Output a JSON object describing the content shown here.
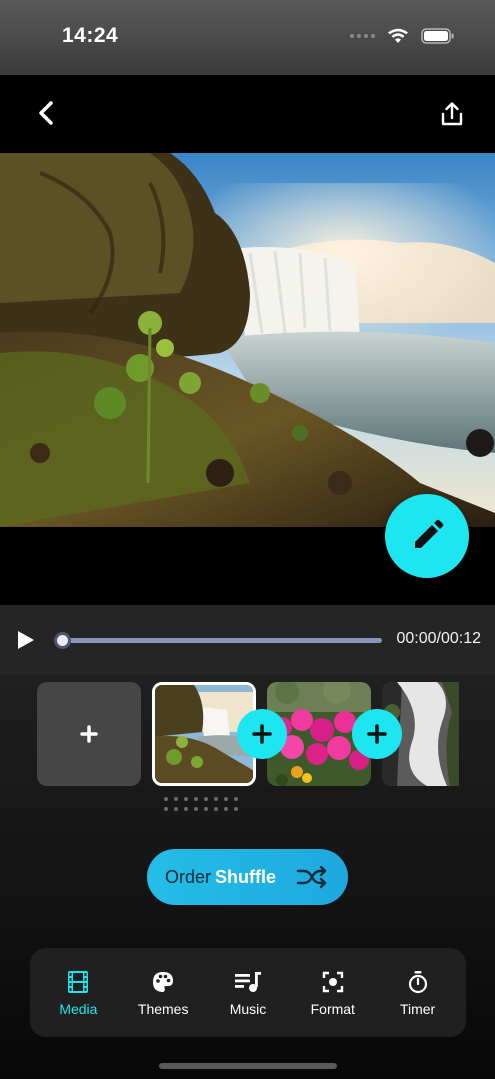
{
  "status_bar": {
    "time": "14:24"
  },
  "nav": {
    "back_icon": "chevron-left-icon",
    "share_icon": "share-icon"
  },
  "preview": {
    "image": "waterfall-landscape",
    "edit_icon": "pencil-icon"
  },
  "player": {
    "time_readout": "00:00/00:12",
    "progress": 0
  },
  "timeline": {
    "clips": [
      {
        "name": "waterfall",
        "selected": true
      },
      {
        "name": "pink-flowers",
        "selected": false
      },
      {
        "name": "waterfall-bw",
        "selected": false
      }
    ]
  },
  "order": {
    "label": "Order",
    "mode": "Shuffle",
    "icon": "shuffle-icon"
  },
  "tabs": [
    {
      "label": "Media",
      "icon": "film-icon",
      "active": true
    },
    {
      "label": "Themes",
      "icon": "palette-icon",
      "active": false
    },
    {
      "label": "Music",
      "icon": "music-icon",
      "active": false
    },
    {
      "label": "Format",
      "icon": "format-icon",
      "active": false
    },
    {
      "label": "Timer",
      "icon": "timer-icon",
      "active": false
    }
  ],
  "colors": {
    "accent": "#1ee6f0",
    "order_button": "#24bde6"
  }
}
